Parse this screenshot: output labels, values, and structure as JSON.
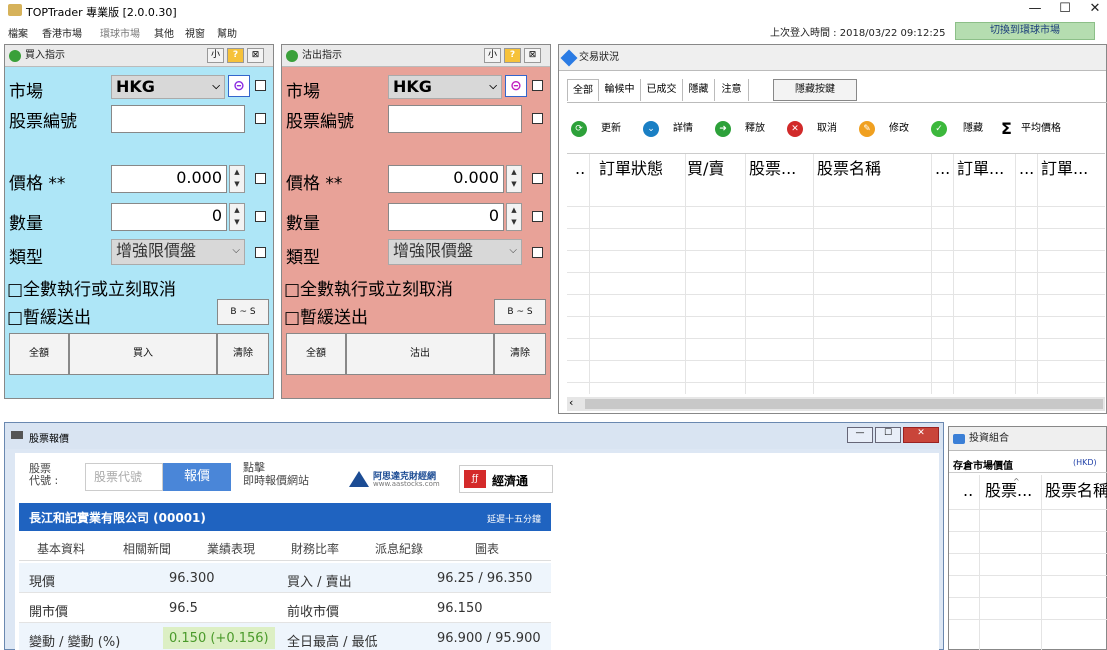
{
  "window": {
    "title": "TOPTrader 專業版 [2.0.0.30]",
    "minimize": "—",
    "maximize": "☐",
    "close": "✕"
  },
  "menu": [
    "檔案",
    "香港市場",
    "環球市場",
    "其他",
    "視窗",
    "幫助"
  ],
  "last_login": "上次登入時間 : 2018/03/22 09:12:25",
  "switch_button": "切換到環球市場",
  "buy_panel": {
    "title": "買入指示",
    "small": "小",
    "help": "?",
    "close": "⊠",
    "market_label": "市場",
    "market_value": "HKG",
    "stock_label": "股票編號",
    "stock_value": "",
    "price_label": "價格 **",
    "price_value": "0.000",
    "qty_label": "數量",
    "qty_value": "0",
    "type_label": "類型",
    "type_value": "增強限價盤",
    "fok_label": "□全數執行或立刻取消",
    "hold_label": "□暫緩送出",
    "bs_button": "B ~ S",
    "all_button": "全額",
    "action_button": "買入",
    "clear_button": "清除"
  },
  "sell_panel": {
    "title": "沽出指示",
    "small": "小",
    "help": "?",
    "close": "⊠",
    "market_label": "市場",
    "market_value": "HKG",
    "stock_label": "股票編號",
    "stock_value": "",
    "price_label": "價格 **",
    "price_value": "0.000",
    "qty_label": "數量",
    "qty_value": "0",
    "type_label": "類型",
    "type_value": "增強限價盤",
    "fok_label": "□全數執行或立刻取消",
    "hold_label": "□暫緩送出",
    "bs_button": "B ~ S",
    "all_button": "全額",
    "action_button": "沽出",
    "clear_button": "清除"
  },
  "trade_panel": {
    "title": "交易狀況",
    "tabs": [
      "全部",
      "輪候中",
      "已成交",
      "隱藏",
      "注意"
    ],
    "hide_button": "隱藏按鍵",
    "toolbar": [
      "更新",
      "詳情",
      "釋放",
      "取消",
      "修改",
      "隱藏",
      "平均價格"
    ],
    "columns": [
      "..",
      "訂單狀態",
      "買/賣",
      "股票...",
      "股票名稱",
      "...",
      "訂單...",
      "...",
      "訂單..."
    ]
  },
  "quote_panel": {
    "title": "股票報價",
    "code_label": "股票\n代號 :",
    "code_placeholder": "股票代號",
    "quote_button": "報價",
    "link_text": "點擊\n即時報價網站",
    "aastocks": "阿思達克財經網",
    "aastocks_url": "www.aastocks.com",
    "etnet": "經濟通",
    "company": "長江和記實業有限公司 (00001)",
    "delay": "延遲十五分鐘",
    "subtabs": [
      "基本資料",
      "相關新聞",
      "業績表現",
      "財務比率",
      "派息紀錄",
      "圖表"
    ],
    "rows": [
      [
        "現價",
        "96.300",
        "買入 / 賣出",
        "96.25 / 96.350"
      ],
      [
        "開市價",
        "96.5",
        "前收市價",
        "96.150"
      ],
      [
        "變動 / 變動 (%)",
        "0.150 (+0.156)",
        "全日最高 / 最低",
        "96.900 / 95.900"
      ]
    ]
  },
  "portfolio_panel": {
    "title": "投資組合",
    "market_value_label": "存倉市場價值",
    "currency": "(HKD)",
    "columns": [
      "..",
      "股票...",
      "股票名稱"
    ]
  }
}
